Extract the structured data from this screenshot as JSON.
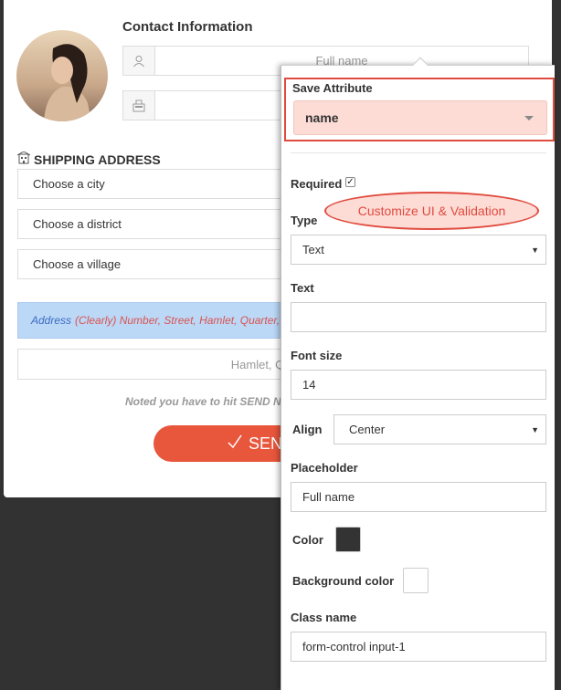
{
  "form": {
    "contact_title": "Contact Information",
    "fullname_placeholder": "Full name",
    "shipping_title": "SHIPPING ADDRESS",
    "city": "Choose a city",
    "district": "Choose a district",
    "village": "Choose a village",
    "address_label": "Address",
    "address_hint": "(Clearly) Number, Street, Hamlet, Quarter, e",
    "hamlet_placeholder": "Hamlet, Quarter",
    "noted": "Noted you have to hit SEND N",
    "send_label": "SEN"
  },
  "panel": {
    "save_attribute_label": "Save Attribute",
    "save_attribute_value": "name",
    "required_label": "Required",
    "required_checked": true,
    "customize_label": "Customize UI & Validation",
    "type_label": "Type",
    "type_value": "Text",
    "text_label": "Text",
    "text_value": "",
    "font_size_label": "Font size",
    "font_size_value": "14",
    "align_label": "Align",
    "align_value": "Center",
    "placeholder_label": "Placeholder",
    "placeholder_value": "Full name",
    "color_label": "Color",
    "color_value": "#333333",
    "bg_color_label": "Background color",
    "bg_color_value": "#ffffff",
    "class_name_label": "Class name",
    "class_name_value": "form-control input-1"
  },
  "colors": {
    "accent": "#e04b3f",
    "send_button": "#e8563b",
    "highlight_fill": "#fddcd6",
    "info_fill": "#bcd8f7"
  },
  "icons": {
    "user": "user-icon",
    "phone": "phone-icon",
    "shipping": "building-icon",
    "checkmark": "checkmark-icon",
    "caret": "caret-down-icon"
  }
}
